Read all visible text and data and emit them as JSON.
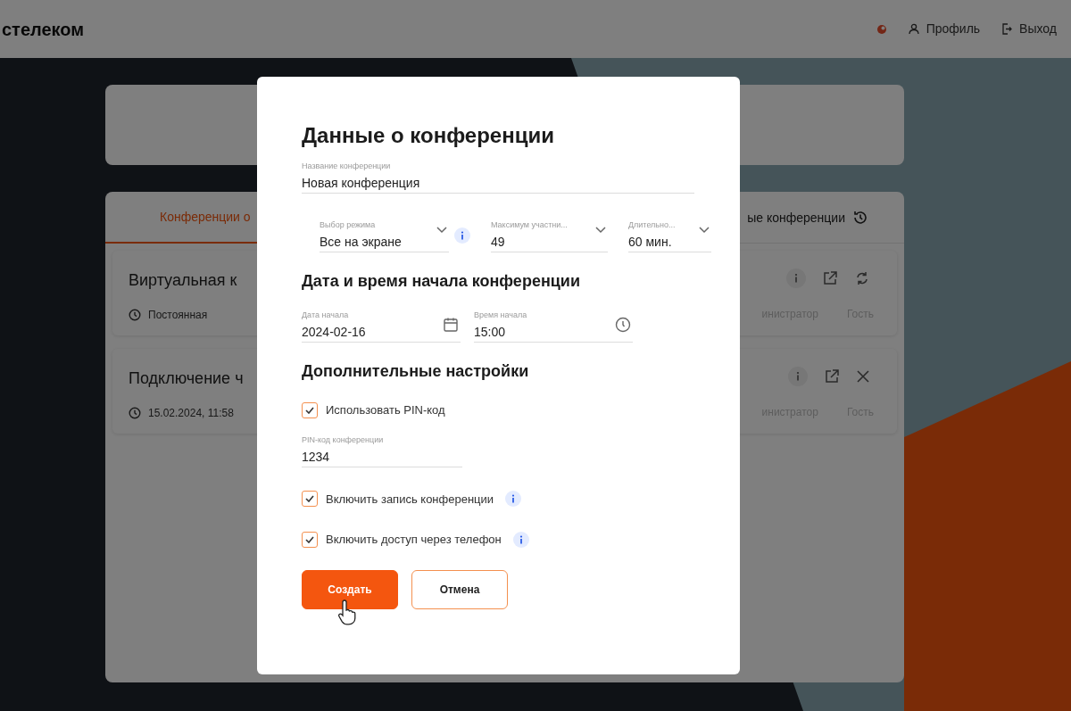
{
  "header": {
    "logo": "стелеком",
    "profile": "Профиль",
    "logout": "Выход"
  },
  "tabs": [
    {
      "label": "Конференции о",
      "selected": true
    },
    {
      "label": "ые конференции",
      "selected": false
    }
  ],
  "conferences": [
    {
      "title": "Виртуальная к",
      "meta": "Постоянная",
      "actions": [
        {
          "kind": "info"
        },
        {
          "kind": "edit"
        },
        {
          "kind": "refresh"
        }
      ],
      "roles": [
        "инистратор",
        "Гость"
      ]
    },
    {
      "title": "Подключение ч",
      "meta": "15.02.2024, 11:58",
      "actions": [
        {
          "kind": "info"
        },
        {
          "kind": "edit"
        },
        {
          "kind": "close"
        }
      ],
      "roles": [
        "инистратор",
        "Гость"
      ]
    }
  ],
  "dialog": {
    "title": "Данные о конференции",
    "name_field": {
      "label": "Название конференции",
      "value": "Новая конференция"
    },
    "selects": [
      {
        "label": "Выбор режима",
        "value": "Все на экране",
        "info": true
      },
      {
        "label": "Максимум участни...",
        "value": "49",
        "info": false
      },
      {
        "label": "Длительно...",
        "value": "60 мин.",
        "info": false
      }
    ],
    "schedule_heading": "Дата и время начала конференции",
    "schedule": [
      {
        "kind": "date",
        "label": "Дата начала",
        "value": "2024-02-16"
      },
      {
        "kind": "time",
        "label": "Время начала",
        "value": "15:00"
      }
    ],
    "settings_heading": "Дополнительные настройки",
    "settings": [
      {
        "kind": "checkbox",
        "label": "Использовать PIN-код",
        "checked": true,
        "info": false
      },
      {
        "kind": "field",
        "label": "PIN-код конференции",
        "value": "1234"
      },
      {
        "kind": "checkbox",
        "label": "Включить запись конференции",
        "checked": true,
        "info": true
      },
      {
        "kind": "checkbox",
        "label": "Включить доступ через телефон",
        "checked": true,
        "info": true
      }
    ],
    "buttons": [
      {
        "kind": "primary",
        "label": "Создать"
      },
      {
        "kind": "secondary",
        "label": "Отмена"
      }
    ]
  }
}
